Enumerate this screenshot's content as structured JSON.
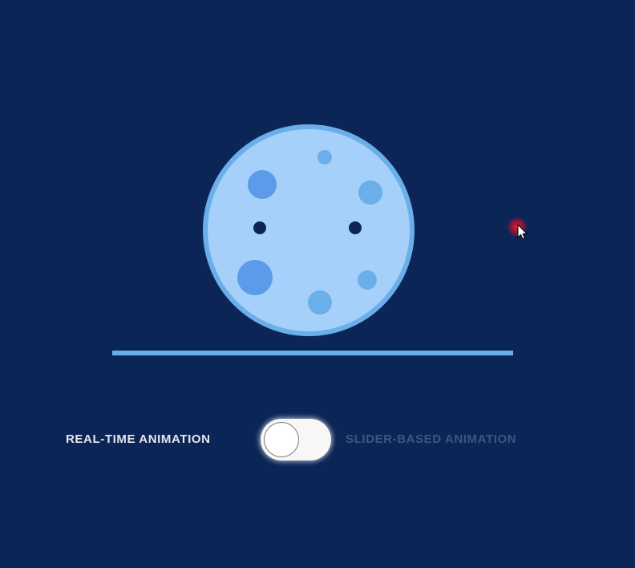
{
  "scene": {
    "background_color": "#0b2556",
    "moon_color": "#a4d0fa",
    "moon_rim_color": "#6aaeea",
    "crater_color": "#5b9bea",
    "eye_color": "#0b2556",
    "ground_line_color": "#6aaeea"
  },
  "toggle": {
    "left_label": "REAL-TIME ANIMATION",
    "right_label": "SLIDER-BASED ANIMATION",
    "active_mode": "REAL-TIME ANIMATION",
    "state": "off"
  },
  "cursor": {
    "icon": "arrow-pointer-icon",
    "highlight_color": "#e0112c"
  }
}
